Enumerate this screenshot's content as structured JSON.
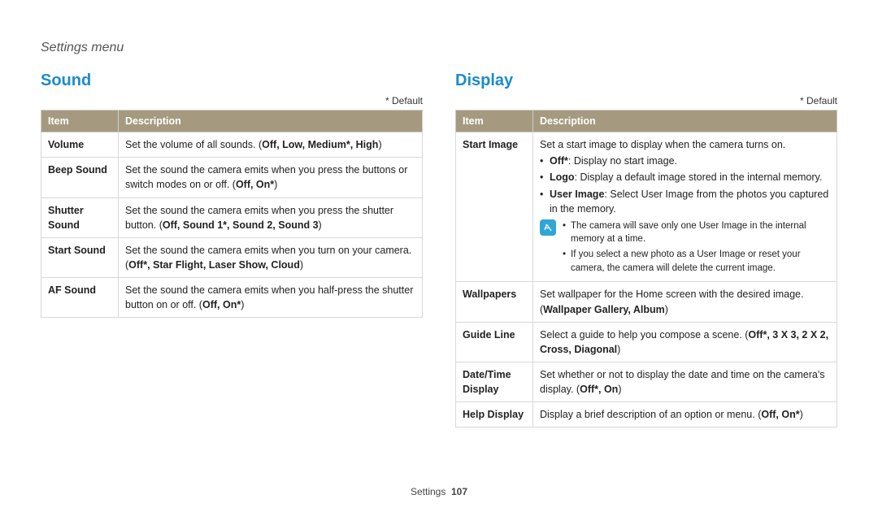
{
  "breadcrumb": "Settings menu",
  "default_label": "* Default",
  "table_headers": {
    "item": "Item",
    "description": "Description"
  },
  "sound": {
    "heading": "Sound",
    "rows": {
      "volume": {
        "item": "Volume",
        "desc_pre": "Set the volume of all sounds. (",
        "opts": "Off, Low, Medium*, High",
        "desc_post": ")"
      },
      "beep": {
        "item": "Beep Sound",
        "desc_pre": "Set the sound the camera emits when you press the buttons or switch modes on or off. (",
        "opts": "Off, On*",
        "desc_post": ")"
      },
      "shutter": {
        "item": "Shutter Sound",
        "desc_pre": "Set the sound the camera emits when you press the shutter button. (",
        "opts": "Off, Sound 1*, Sound 2, Sound 3",
        "desc_post": ")"
      },
      "start": {
        "item": "Start Sound",
        "desc_pre": "Set the sound the camera emits when you turn on your camera. (",
        "opts": "Off*, Star Flight, Laser Show, Cloud",
        "desc_post": ")"
      },
      "af": {
        "item": "AF Sound",
        "desc_pre": "Set the sound the camera emits when you half-press the shutter button on or off. (",
        "opts": "Off, On*",
        "desc_post": ")"
      }
    }
  },
  "display": {
    "heading": "Display",
    "start_image": {
      "item": "Start Image",
      "intro": "Set a start image to display when the camera turns on.",
      "b_off_label": "Off*",
      "b_off_text": ": Display no start image.",
      "b_logo_label": "Logo",
      "b_logo_text": ": Display a default image stored in the internal memory.",
      "b_user_label": "User Image",
      "b_user_text": ": Select User Image from the photos you captured in the memory.",
      "note1": "The camera will save only one User Image in the internal memory at a time.",
      "note2": "If you select a new photo as a User Image or reset your camera, the camera will delete the current image."
    },
    "wallpapers": {
      "item": "Wallpapers",
      "desc_pre": "Set wallpaper for the Home screen with the desired image. (",
      "opts": "Wallpaper Gallery, Album",
      "desc_post": ")"
    },
    "guideline": {
      "item": "Guide Line",
      "desc_pre": "Select a guide to help you compose a scene. (",
      "opts": "Off*, 3 X 3, 2 X 2, Cross, Diagonal",
      "desc_post": ")"
    },
    "datetime": {
      "item": "Date/Time Display",
      "desc_pre": "Set whether or not to display the date and time on the camera's display. (",
      "opts": "Off*, On",
      "desc_post": ")"
    },
    "help": {
      "item": "Help Display",
      "desc_pre": "Display a brief description of an option or menu. (",
      "opts": "Off, On*",
      "desc_post": ")"
    }
  },
  "footer": {
    "section": "Settings",
    "page": "107"
  }
}
